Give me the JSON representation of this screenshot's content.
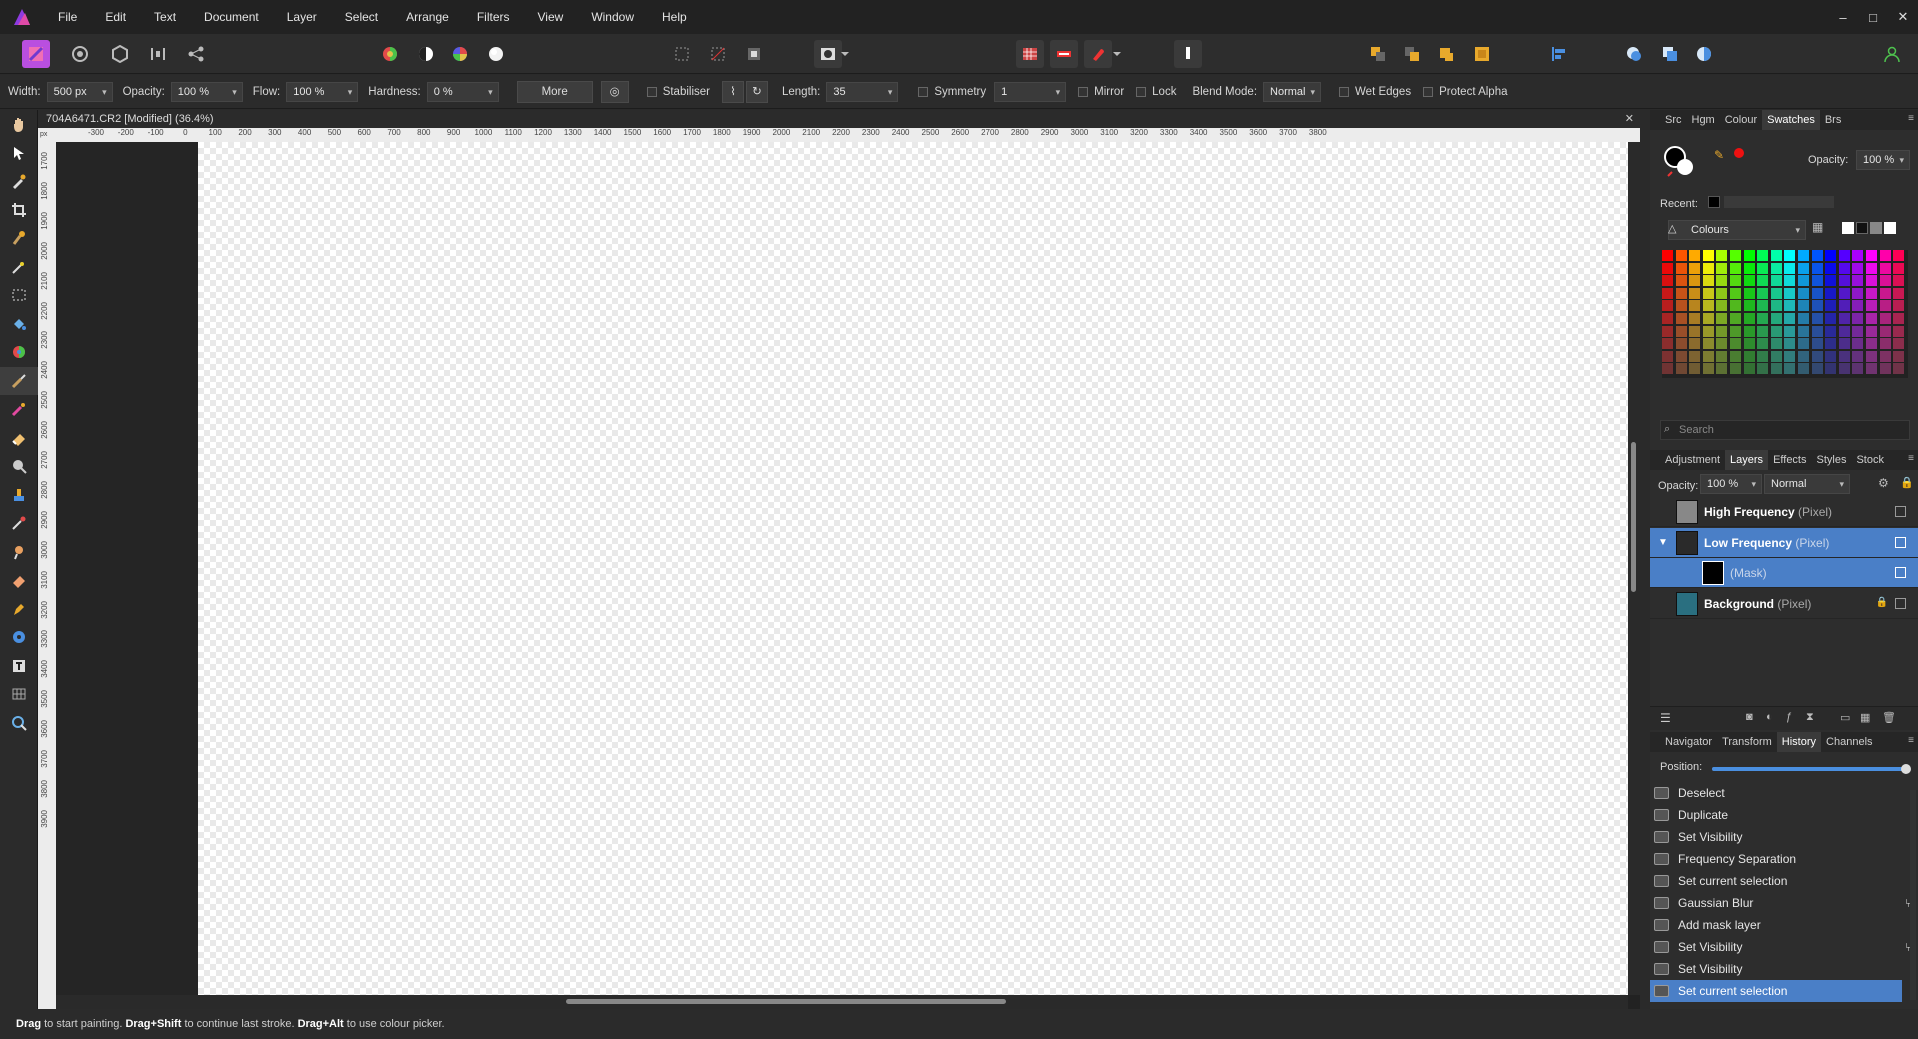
{
  "menu": {
    "items": [
      "File",
      "Edit",
      "Text",
      "Document",
      "Layer",
      "Select",
      "Arrange",
      "Filters",
      "View",
      "Window",
      "Help"
    ]
  },
  "window_controls": {
    "minimize": "–",
    "maximize": "□",
    "close": "✕"
  },
  "context": {
    "width_label": "Width:",
    "width_value": "500 px",
    "opacity_label": "Opacity:",
    "opacity_value": "100 %",
    "flow_label": "Flow:",
    "flow_value": "100 %",
    "hardness_label": "Hardness:",
    "hardness_value": "0 %",
    "more_label": "More",
    "stabiliser_label": "Stabiliser",
    "length_label": "Length:",
    "length_value": "35",
    "symmetry_label": "Symmetry",
    "symmetry_value": "1",
    "mirror_label": "Mirror",
    "lock_label": "Lock",
    "blend_label": "Blend Mode:",
    "blend_value": "Normal",
    "wet_edges_label": "Wet Edges",
    "protect_alpha_label": "Protect Alpha"
  },
  "document": {
    "tab_title": "704A6471.CR2 [Modified] (36.4%)",
    "close_glyph": "✕",
    "ruler_unit": "px",
    "h_ticks": [
      "-300",
      "-200",
      "-100",
      "0",
      "100",
      "200",
      "300",
      "400",
      "500",
      "600",
      "700",
      "800",
      "900",
      "1000",
      "1100",
      "1200",
      "1300",
      "1400",
      "1500",
      "1600",
      "1700",
      "1800",
      "1900",
      "2000",
      "2100",
      "2200",
      "2300",
      "2400",
      "2500",
      "2600",
      "2700",
      "2800",
      "2900",
      "3000",
      "3100",
      "3200",
      "3300",
      "3400",
      "3500",
      "3600",
      "3700",
      "3800"
    ],
    "v_ticks": [
      "1700",
      "1800",
      "1900",
      "2000",
      "2100",
      "2200",
      "2300",
      "2400",
      "2500",
      "2600",
      "2700",
      "2800",
      "2900",
      "3000",
      "3100",
      "3200",
      "3300",
      "3400",
      "3500",
      "3600",
      "3700",
      "3800",
      "3900"
    ]
  },
  "swatches_panel": {
    "tabs": [
      "Src",
      "Hgm",
      "Colour",
      "Swatches",
      "Brs"
    ],
    "active_tab": "Swatches",
    "opacity_label": "Opacity:",
    "opacity_value": "100 %",
    "recent_label": "Recent:",
    "palette_name": "Colours",
    "search_placeholder": "Search"
  },
  "layers_panel": {
    "tabs": [
      "Adjustment",
      "Layers",
      "Effects",
      "Styles",
      "Stock"
    ],
    "active_tab": "Layers",
    "opacity_label": "Opacity:",
    "opacity_value": "100 %",
    "blend_value": "Normal",
    "layers": [
      {
        "name": "High Frequency",
        "type": "(Pixel)",
        "selected": false
      },
      {
        "name": "Low Frequency",
        "type": "(Pixel)",
        "selected": true
      },
      {
        "name": "",
        "type": "(Mask)",
        "selected": true
      },
      {
        "name": "Background",
        "type": "(Pixel)",
        "selected": false
      }
    ]
  },
  "history_panel": {
    "tabs": [
      "Navigator",
      "Transform",
      "History",
      "Channels"
    ],
    "active_tab": "History",
    "position_label": "Position:",
    "position_value": 1.0,
    "items": [
      "Deselect",
      "Duplicate",
      "Set Visibility",
      "Frequency Separation",
      "Set current selection",
      "Gaussian Blur",
      "Add mask layer",
      "Set Visibility",
      "Set Visibility",
      "Set current selection"
    ],
    "selected_index": 9
  },
  "status": {
    "drag1": "Drag",
    "text1": " to start painting. ",
    "drag2": "Drag+Shift",
    "text2": " to continue last stroke. ",
    "drag3": "Drag+Alt",
    "text3": " to use colour picker."
  },
  "colors": {
    "accent": "#4a7fc7",
    "brand": "#c13fd9"
  }
}
